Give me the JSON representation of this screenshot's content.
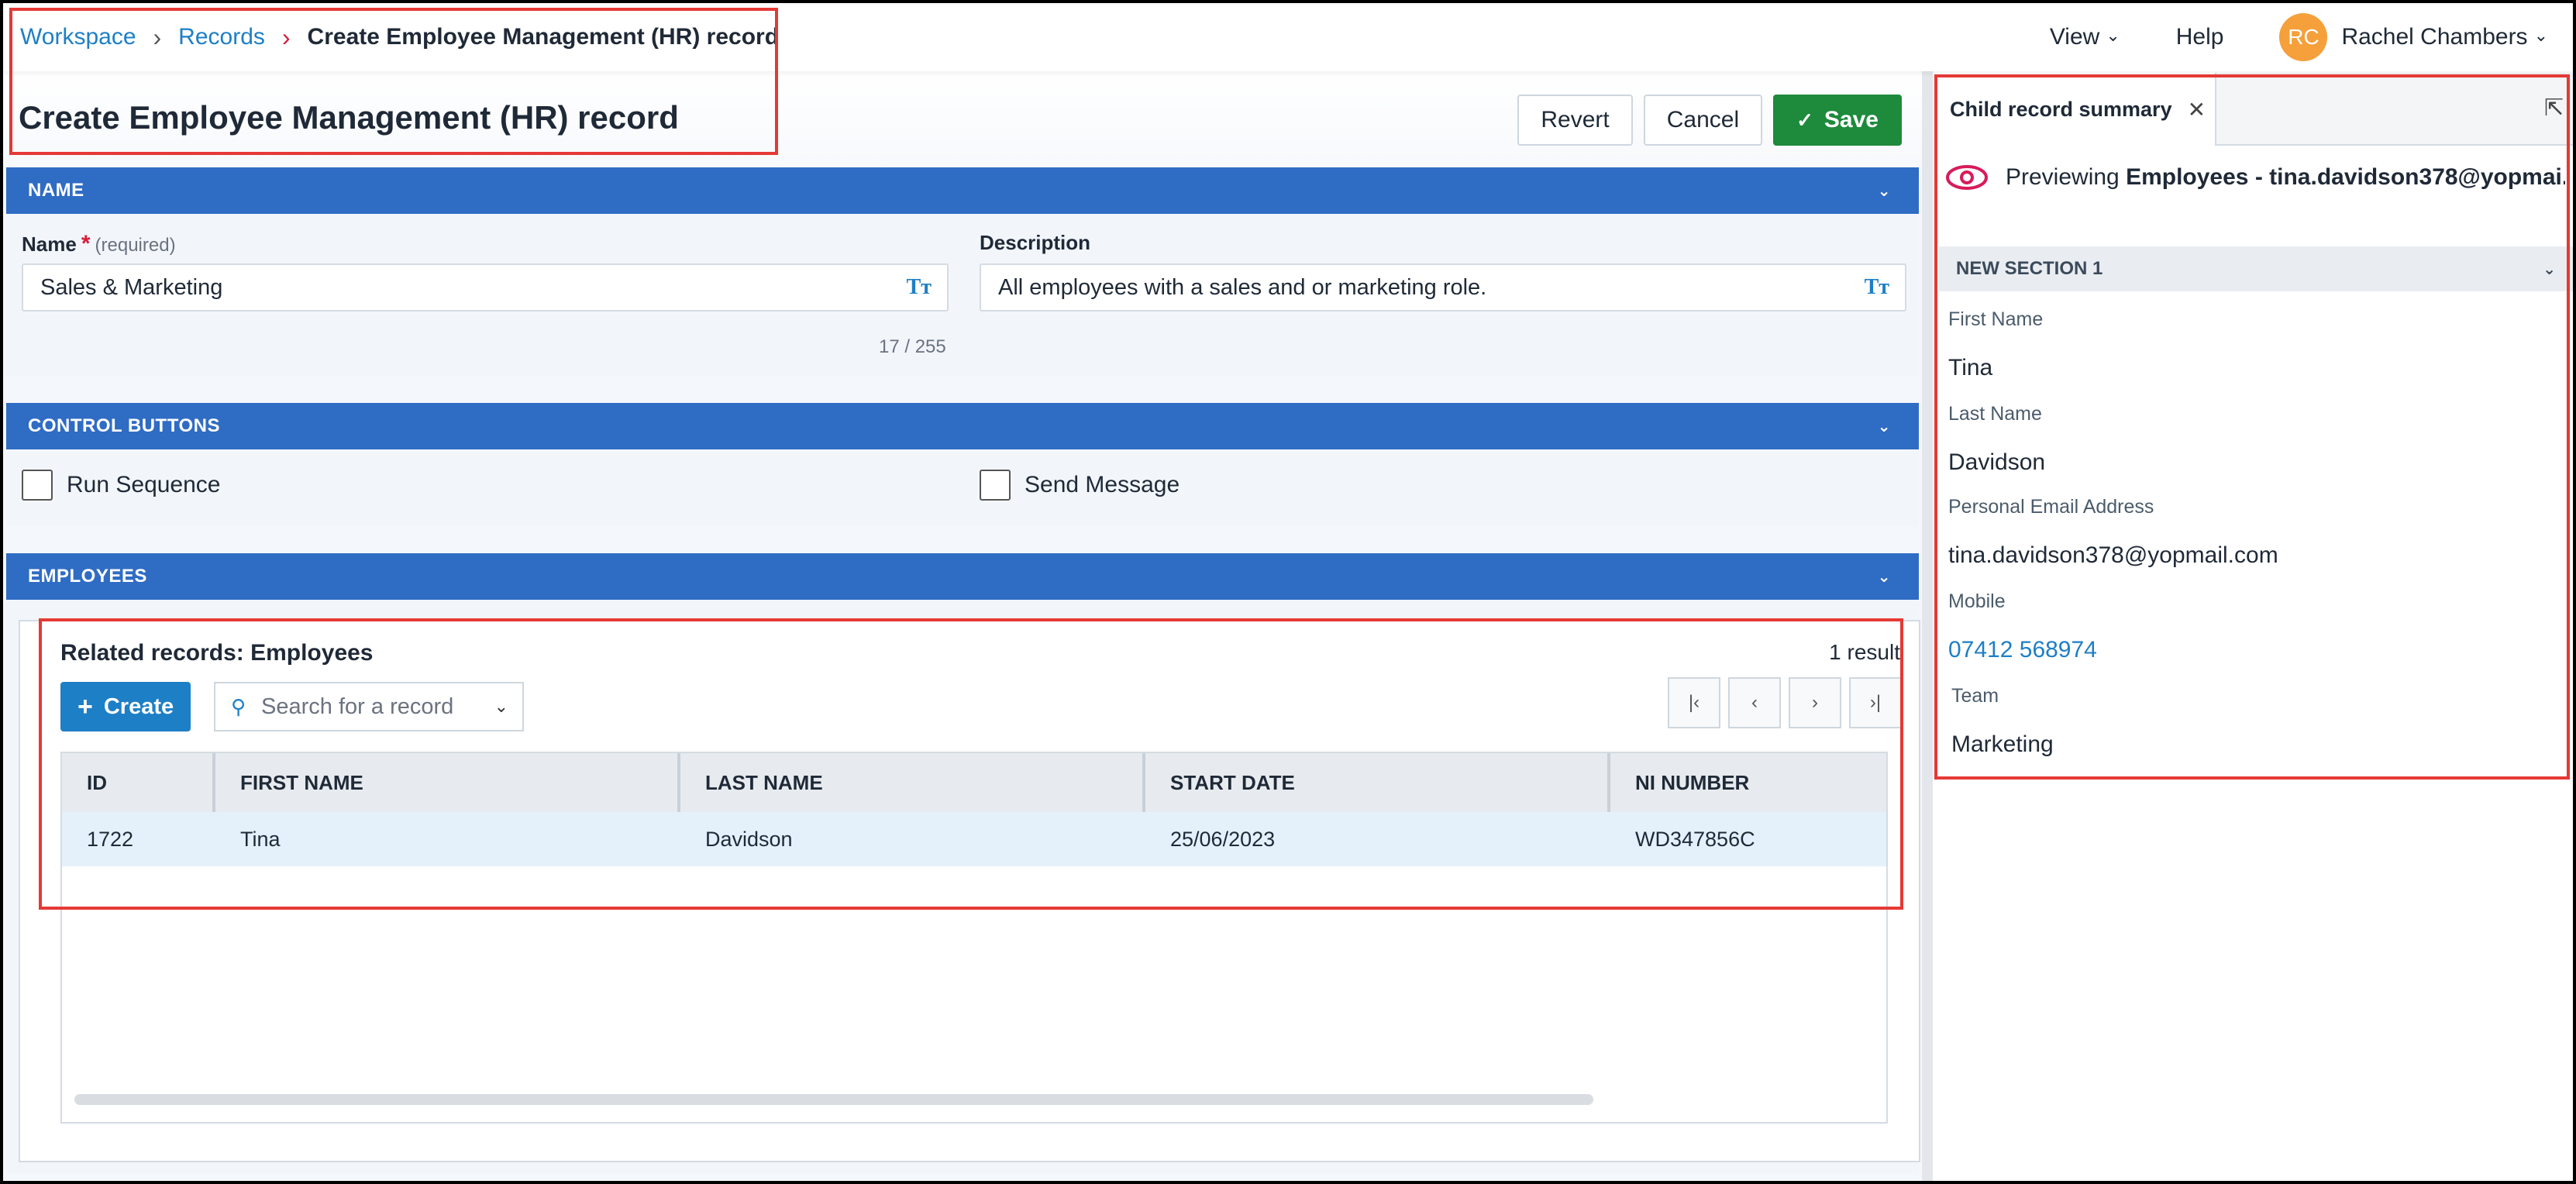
{
  "breadcrumb": {
    "items": [
      "Workspace",
      "Records"
    ],
    "current": "Create Employee Management (HR) record"
  },
  "topnav": {
    "view_label": "View",
    "help_label": "Help",
    "user_initials": "RC",
    "user_name": "Rachel Chambers"
  },
  "page": {
    "title": "Create Employee Management (HR) record"
  },
  "actions": {
    "revert_label": "Revert",
    "cancel_label": "Cancel",
    "save_label": "Save"
  },
  "sections": {
    "name": {
      "title": "NAME",
      "name_label": "Name",
      "name_required_marker": "*",
      "name_required_note": "(required)",
      "name_value": "Sales & Marketing",
      "name_char_count": "17 / 255",
      "description_label": "Description",
      "description_value": "All employees with a sales and or marketing role."
    },
    "control_buttons": {
      "title": "CONTROL BUTTONS",
      "run_sequence_label": "Run Sequence",
      "send_message_label": "Send Message"
    },
    "employees": {
      "title": "EMPLOYEES",
      "related_title": "Related records: Employees",
      "result_count": "1 result",
      "create_label": "Create",
      "search_placeholder": "Search for a record",
      "columns": [
        "ID",
        "FIRST NAME",
        "LAST NAME",
        "START DATE",
        "NI NUMBER"
      ],
      "rows": [
        {
          "id": "1722",
          "first_name": "Tina",
          "last_name": "Davidson",
          "start_date": "25/06/2023",
          "ni_number": "WD347856C"
        }
      ]
    }
  },
  "panel": {
    "tab_label": "Child record summary",
    "preview_prefix": "Previewing",
    "preview_record": "Employees - tina.davidson378@yopmai...",
    "section_title": "NEW SECTION 1",
    "fields": {
      "first_name_label": "First Name",
      "first_name_value": "Tina",
      "last_name_label": "Last Name",
      "last_name_value": "Davidson",
      "email_label": "Personal Email Address",
      "email_value": "tina.davidson378@yopmail.com",
      "mobile_label": "Mobile",
      "mobile_value": "07412 568974",
      "team_label": "Team",
      "team_value": "Marketing"
    }
  },
  "icons": {
    "breadcrumb_separator": "chevron-right-icon",
    "text_format": "text-format-icon",
    "search": "search-icon",
    "close": "close-icon",
    "preview": "eye-icon",
    "popout": "popout-icon"
  },
  "colors": {
    "accent": "#1d7fc6",
    "section_bar": "#2f6cc4",
    "save": "#1e8a3c",
    "avatar": "#f5a03a",
    "required": "#d81b3a",
    "highlight": "#e53935"
  }
}
